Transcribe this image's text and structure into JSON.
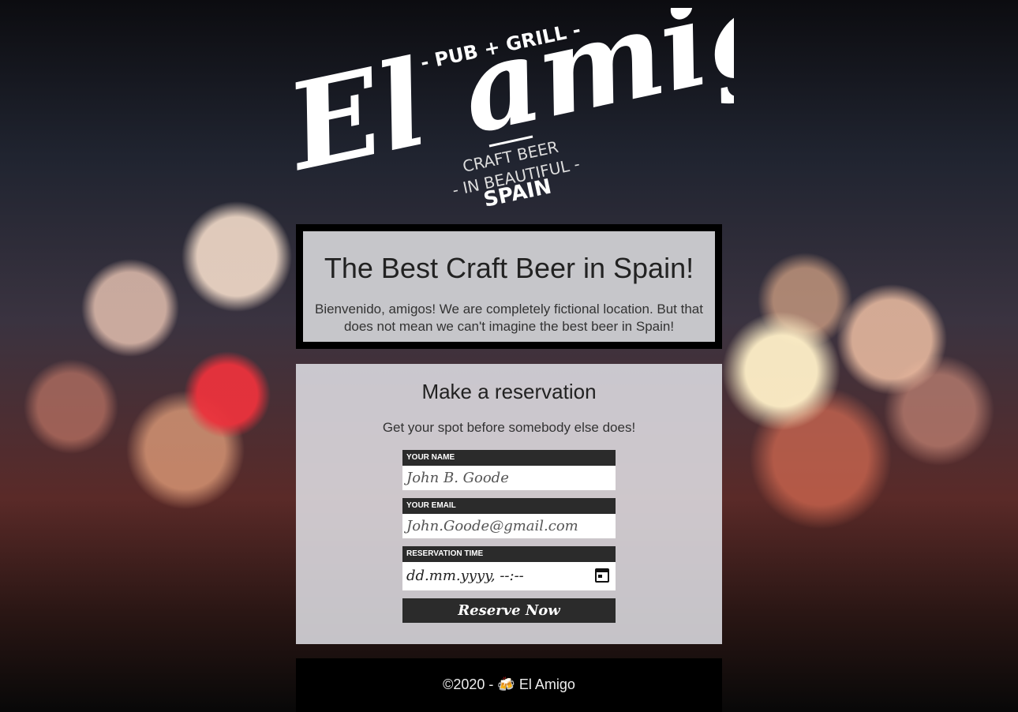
{
  "logo": {
    "script_text": "El amigo",
    "top_line": "- PUB + GRILL -",
    "line1": "CRAFT BEER",
    "line2": "- IN BEAUTIFUL -",
    "line3": "SPAIN"
  },
  "hero": {
    "title": "The Best Craft Beer in Spain!",
    "text": "Bienvenido, amigos! We are completely fictional location. But that does not mean we can't imagine the best beer in Spain!"
  },
  "reservation": {
    "heading": "Make a reservation",
    "subtext": "Get your spot before somebody else does!",
    "name_label": "YOUR NAME",
    "name_placeholder": "John B. Goode",
    "email_label": "YOUR EMAIL",
    "email_placeholder": "John.Goode@gmail.com",
    "time_label": "RESERVATION TIME",
    "time_placeholder": "dd.mm.yyyy, --:--",
    "button": "Reserve Now"
  },
  "footer": {
    "text": "©2020 - 🍻 El Amigo"
  }
}
